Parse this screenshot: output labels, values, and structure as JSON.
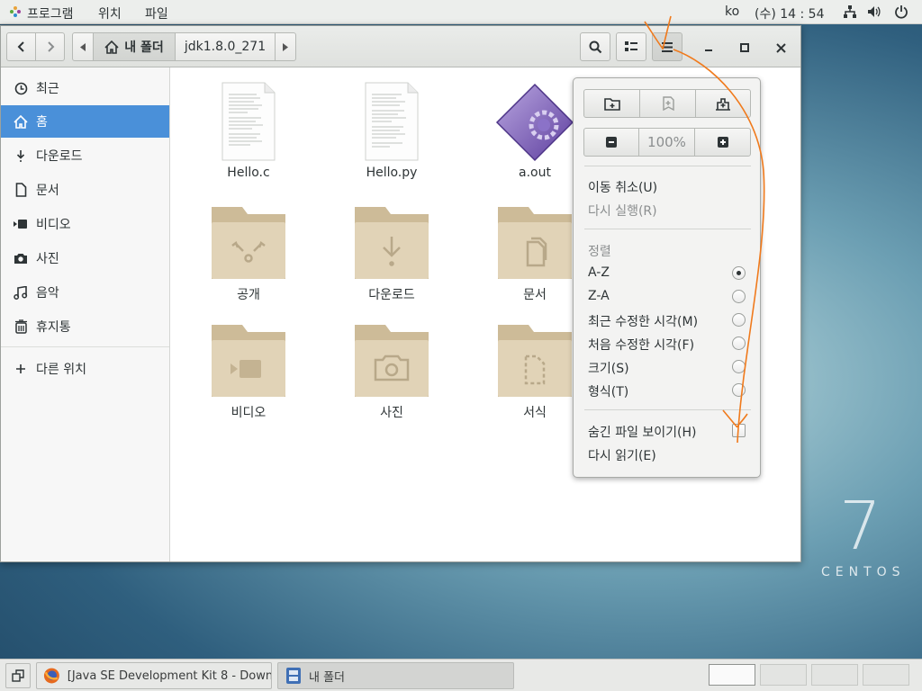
{
  "topbar": {
    "apps_menu": "프로그램",
    "places_menu": "위치",
    "file_menu": "파일",
    "input_method": "ko",
    "clock": "(수) 14 : 54"
  },
  "desktop": {
    "os_number": "7",
    "os_name": "CENTOS"
  },
  "window": {
    "breadcrumb": {
      "home_label": "내 폴더",
      "current": "jdk1.8.0_271"
    }
  },
  "sidebar": {
    "items": [
      {
        "label": "최근",
        "icon": "clock-icon"
      },
      {
        "label": "홈",
        "icon": "home-icon",
        "active": true
      },
      {
        "label": "다운로드",
        "icon": "download-icon"
      },
      {
        "label": "문서",
        "icon": "document-icon"
      },
      {
        "label": "비디오",
        "icon": "video-icon"
      },
      {
        "label": "사진",
        "icon": "camera-icon"
      },
      {
        "label": "음악",
        "icon": "music-icon"
      },
      {
        "label": "휴지통",
        "icon": "trash-icon"
      }
    ],
    "other_locations": "다른 위치"
  },
  "files": [
    {
      "name": "Hello.c",
      "type": "text-file"
    },
    {
      "name": "Hello.py",
      "type": "text-file"
    },
    {
      "name": "a.out",
      "type": "executable"
    },
    {
      "name": "공개",
      "type": "folder-public"
    },
    {
      "name": "다운로드",
      "type": "folder-download"
    },
    {
      "name": "문서",
      "type": "folder-documents"
    },
    {
      "name": "비디오",
      "type": "folder-videos"
    },
    {
      "name": "사진",
      "type": "folder-pictures"
    },
    {
      "name": "서식",
      "type": "folder-templates"
    }
  ],
  "menu": {
    "zoom": "100%",
    "undo": "이동 취소(U)",
    "redo": "다시 실행(R)",
    "sort_heading": "정렬",
    "sort_options": [
      {
        "label": "A-Z",
        "checked": true
      },
      {
        "label": "Z-A",
        "checked": false
      },
      {
        "label": "최근 수정한 시각(M)",
        "checked": false
      },
      {
        "label": "처음 수정한 시각(F)",
        "checked": false
      },
      {
        "label": "크기(S)",
        "checked": false
      },
      {
        "label": "형식(T)",
        "checked": false
      }
    ],
    "show_hidden": "숨긴 파일 보이기(H)",
    "show_hidden_checked": false,
    "reload": "다시 읽기(E)"
  },
  "taskbar": {
    "tasks": [
      {
        "label": "[Java SE Development Kit 8 - Down…",
        "icon": "firefox-icon"
      },
      {
        "label": "내 폴더",
        "icon": "file-manager-icon",
        "active": true
      }
    ],
    "workspaces": 4,
    "active_workspace": 1
  },
  "colors": {
    "selection": "#4a90d9",
    "annotation": "#f07a1c",
    "folder": "#d9c8a8"
  }
}
